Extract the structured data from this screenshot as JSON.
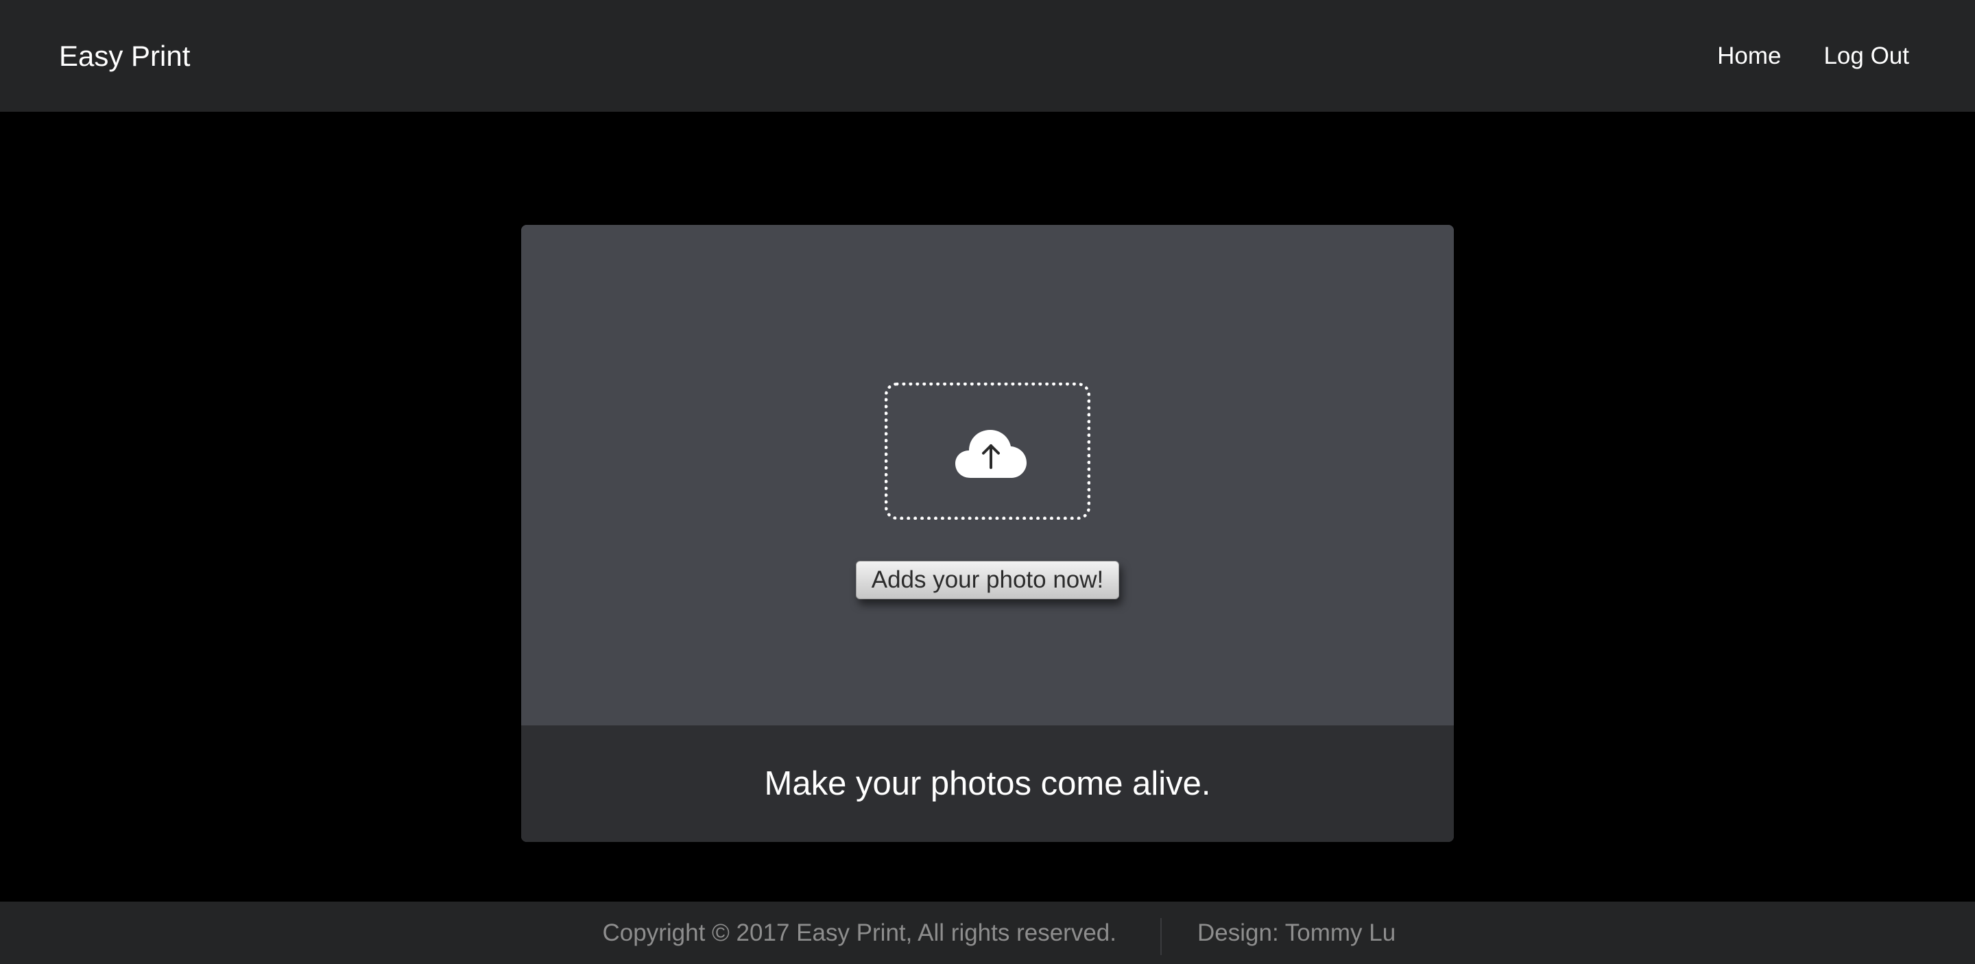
{
  "header": {
    "brand": "Easy Print",
    "nav": [
      "Home",
      "Log Out"
    ]
  },
  "upload": {
    "icon": "cloud-upload-icon",
    "button_label": "Adds your photo now!"
  },
  "tagline": "Make your photos come alive.",
  "footer": {
    "copyright": "Copyright © 2017 Easy Print, All rights reserved.",
    "design": "Design: Tommy Lu"
  },
  "colors": {
    "header_bg": "#242526",
    "page_bg": "#000000",
    "card_bg": "#46484e",
    "tagline_bg": "#2e2f32",
    "footer_text": "#8e8e8e"
  }
}
